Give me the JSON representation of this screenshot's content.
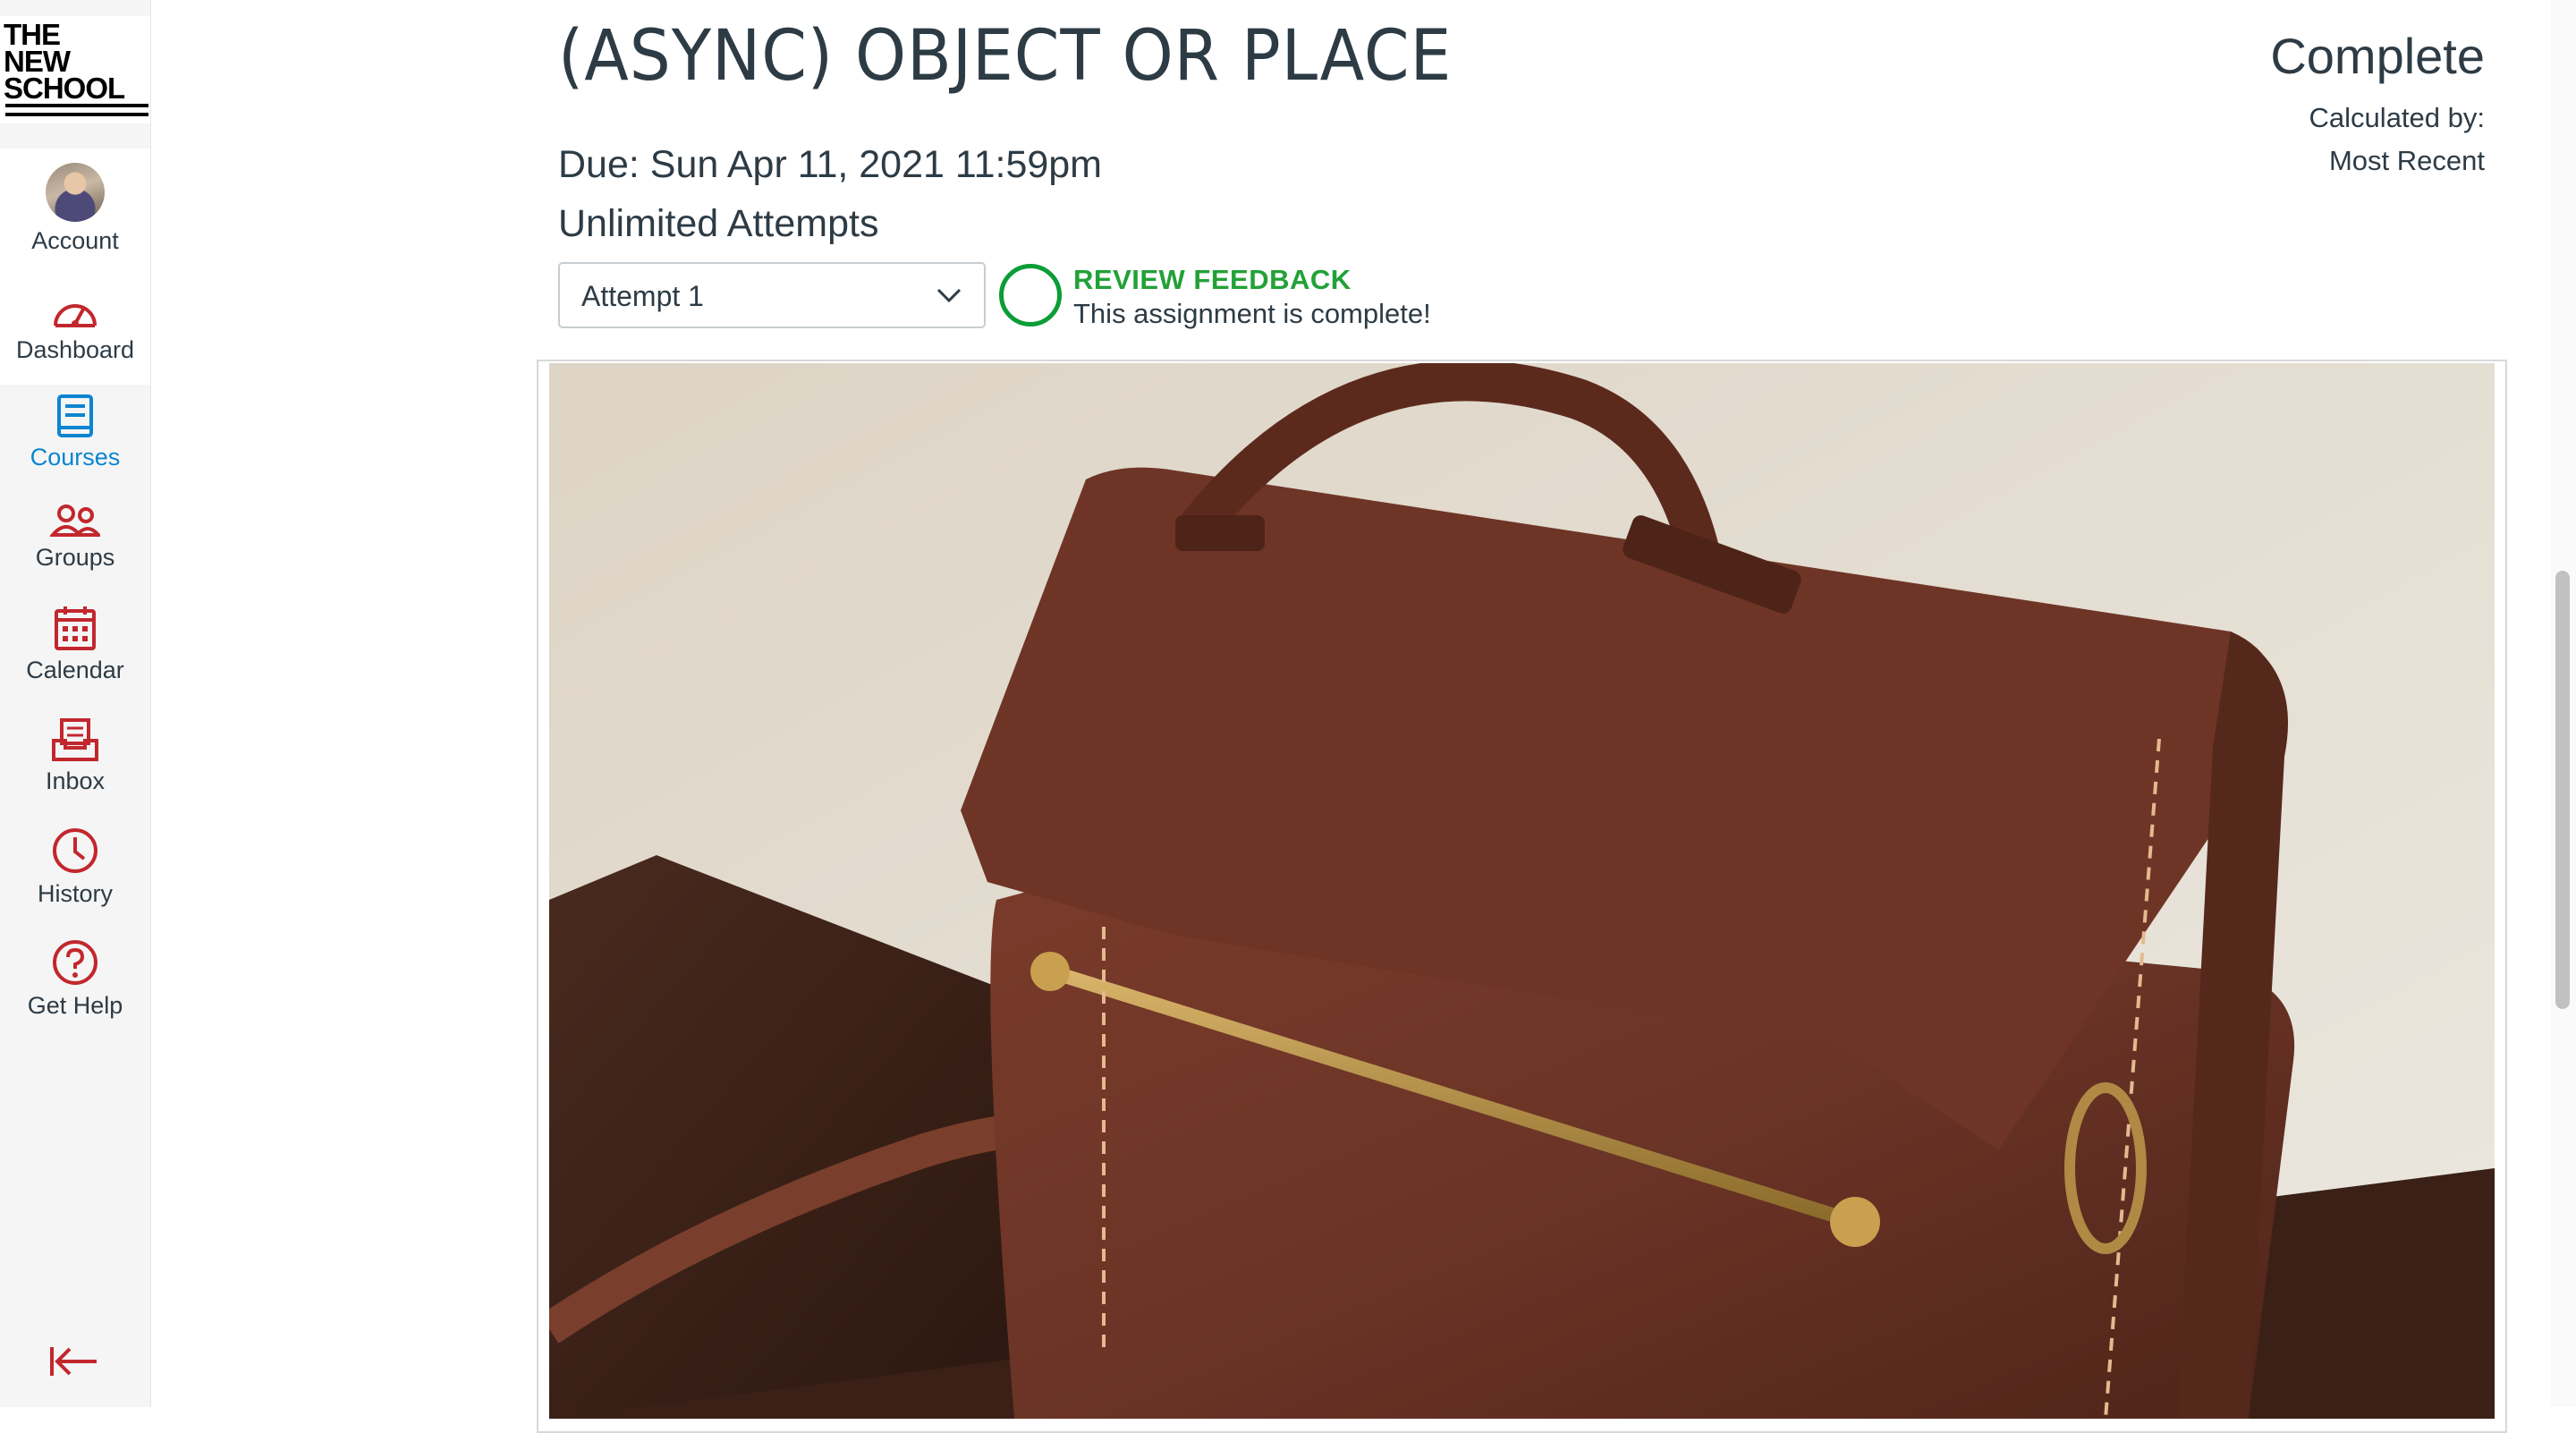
{
  "nav": {
    "logo": [
      "THE",
      "NEW",
      "SCHOOL"
    ],
    "items": [
      {
        "label": "Account",
        "icon": "avatar"
      },
      {
        "label": "Dashboard",
        "icon": "dashboard-icon"
      },
      {
        "label": "Courses",
        "icon": "courses-icon",
        "active": true
      },
      {
        "label": "Groups",
        "icon": "groups-icon"
      },
      {
        "label": "Calendar",
        "icon": "calendar-icon"
      },
      {
        "label": "Inbox",
        "icon": "inbox-icon"
      },
      {
        "label": "History",
        "icon": "history-icon"
      },
      {
        "label": "Get Help",
        "icon": "help-icon"
      }
    ],
    "collapse_icon": "collapse-arrow-icon"
  },
  "assignment": {
    "title": "(ASYNC) OBJECT OR PLACE",
    "due": "Due: Sun Apr 11, 2021 11:59pm",
    "attempts": "Unlimited Attempts"
  },
  "grade": {
    "status": "Complete",
    "calculated_by_label": "Calculated by:",
    "calculated_by_value": "Most Recent"
  },
  "attempt_select": {
    "value": "Attempt 1"
  },
  "feedback": {
    "link": "REVIEW FEEDBACK",
    "message": "This assignment is complete!"
  },
  "colors": {
    "nav_icon": "#c2272d",
    "nav_active": "#0b85d1",
    "success": "#22a137",
    "text": "#2d3b45"
  }
}
